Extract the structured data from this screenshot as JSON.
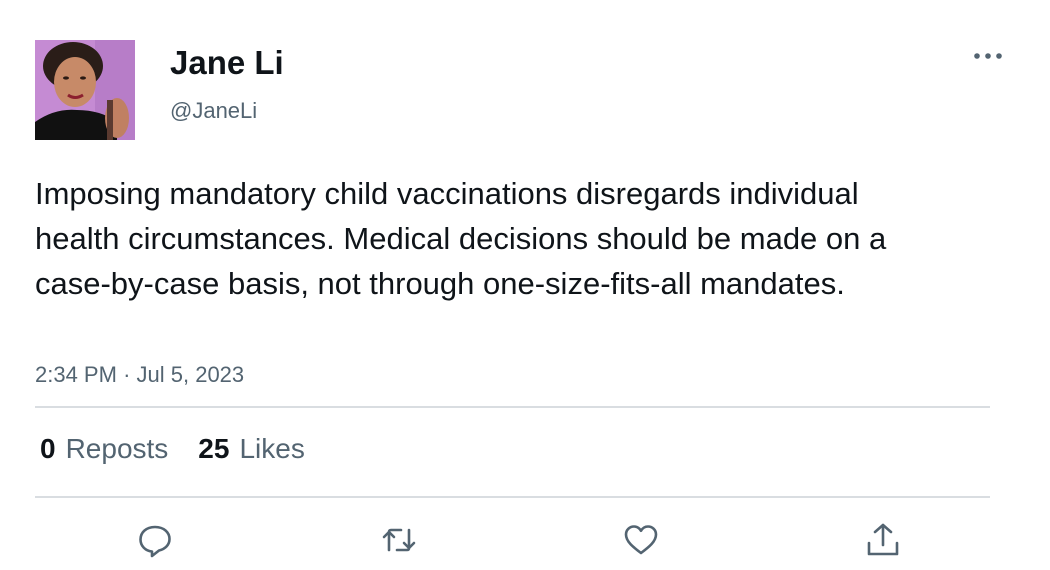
{
  "user": {
    "display_name": "Jane Li",
    "handle": "@JaneLi"
  },
  "tweet": {
    "text": "Imposing mandatory child vaccinations disregards individual health circumstances. Medical decisions should be made on a case-by-case basis, not through one-size-fits-all mandates.",
    "time": "2:34 PM",
    "separator": "·",
    "date": "Jul 5, 2023"
  },
  "stats": {
    "reposts_count": "0",
    "reposts_label": "Reposts",
    "likes_count": "25",
    "likes_label": "Likes"
  },
  "icons": {
    "more": "more-horizontal-icon",
    "reply": "reply-bubble-icon",
    "repost": "repost-arrows-icon",
    "like": "heart-icon",
    "share": "share-upload-icon"
  },
  "colors": {
    "primary_text": "#0f1419",
    "secondary_text": "#536471",
    "divider": "#d9dde1",
    "icon": "#536471",
    "avatar_background": "#c98fd6"
  }
}
